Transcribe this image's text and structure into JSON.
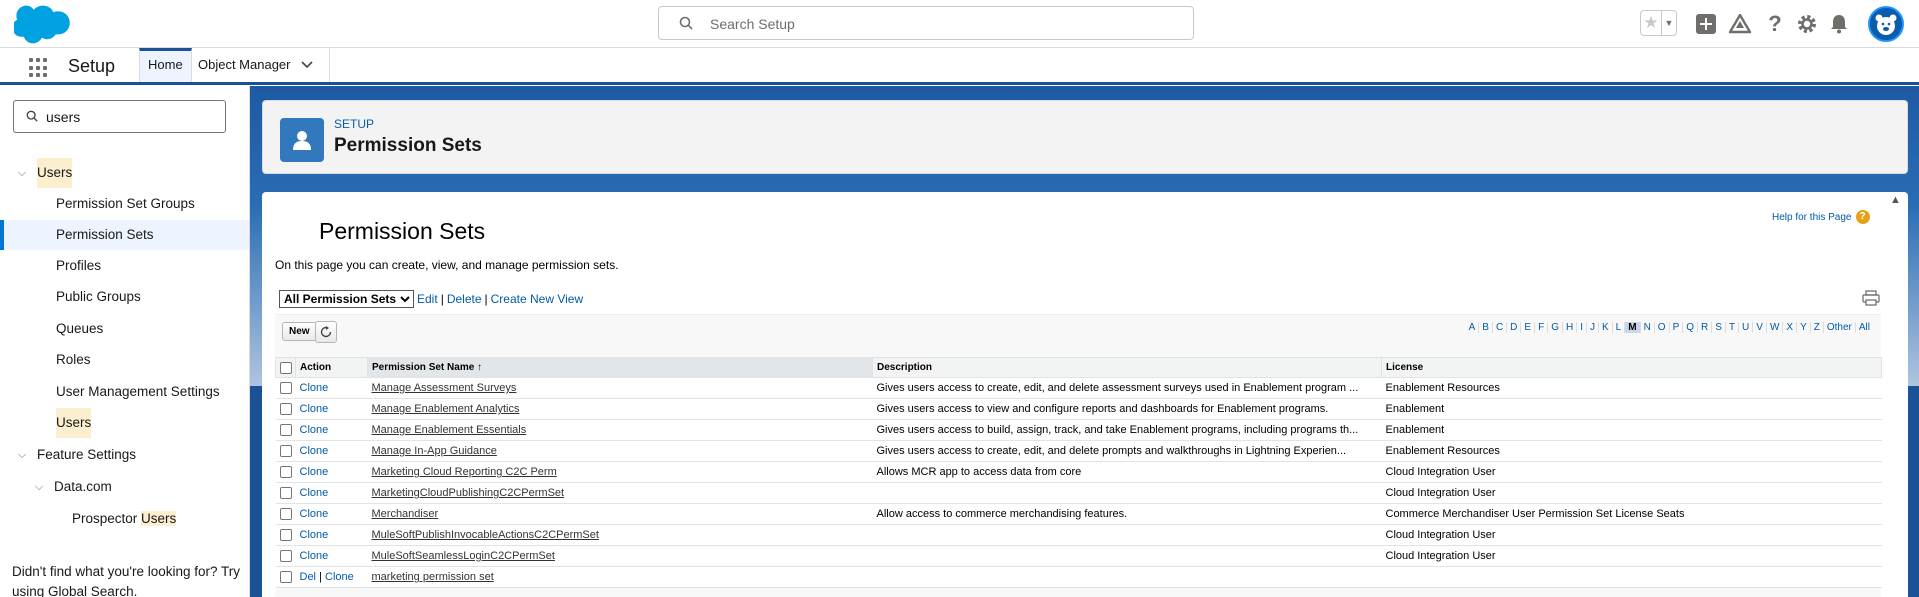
{
  "header": {
    "search_placeholder": "Search Setup",
    "icons": [
      "favorites-star-icon",
      "favorites-dropdown-icon",
      "global-actions-plus-icon",
      "trailhead-icon",
      "help-icon",
      "setup-gear-icon",
      "notifications-bell-icon",
      "avatar"
    ]
  },
  "nav": {
    "app_name": "Setup",
    "tabs": [
      {
        "label": "Home"
      },
      {
        "label": "Object Manager"
      }
    ]
  },
  "sidebar": {
    "quickfind_value": "users",
    "tree": [
      {
        "label": "Users",
        "highlight": true
      },
      {
        "label": "Permission Set Groups"
      },
      {
        "label": "Permission Sets"
      },
      {
        "label": "Profiles"
      },
      {
        "label": "Public Groups"
      },
      {
        "label": "Queues"
      },
      {
        "label": "Roles"
      },
      {
        "label": "User Management Settings"
      },
      {
        "label": "Users"
      },
      {
        "label": "Feature Settings"
      },
      {
        "label": "Data.com"
      },
      {
        "label_prefix": "Prospector ",
        "label_hl": "Users"
      }
    ],
    "not_found": "Didn't find what you're looking for? Try using Global Search."
  },
  "page_header": {
    "eyebrow": "SETUP",
    "title": "Permission Sets"
  },
  "content": {
    "title": "Permission Sets",
    "help_link": "Help for this Page",
    "description": "On this page you can create, view, and manage permission sets.",
    "view_select": "All Permission Sets",
    "view_links": {
      "edit": "Edit",
      "delete": "Delete",
      "create": "Create New View"
    },
    "new_button": "New",
    "alpha": [
      "A",
      "B",
      "C",
      "D",
      "E",
      "F",
      "G",
      "H",
      "I",
      "J",
      "K",
      "L",
      "M",
      "N",
      "O",
      "P",
      "Q",
      "R",
      "S",
      "T",
      "U",
      "V",
      "W",
      "X",
      "Y",
      "Z",
      "Other",
      "All"
    ],
    "alpha_selected": "M",
    "columns": {
      "action": "Action",
      "name": "Permission Set Name ↑",
      "description": "Description",
      "license": "License"
    },
    "rows": [
      {
        "del": "",
        "action": "Clone",
        "name": "Manage Assessment Surveys",
        "description": "Gives users access to create, edit, and delete assessment surveys used in Enablement program ...",
        "license": "Enablement Resources"
      },
      {
        "del": "",
        "action": "Clone",
        "name": "Manage Enablement Analytics",
        "description": "Gives users access to view and configure reports and dashboards for Enablement programs.",
        "license": "Enablement"
      },
      {
        "del": "",
        "action": "Clone",
        "name": "Manage Enablement Essentials",
        "description": "Gives users access to build, assign, track, and take Enablement programs, including programs th...",
        "license": "Enablement"
      },
      {
        "del": "",
        "action": "Clone",
        "name": "Manage In-App Guidance",
        "description": "Gives users access to create, edit, and delete prompts and walkthroughs in Lightning Experien...",
        "license": "Enablement Resources"
      },
      {
        "del": "",
        "action": "Clone",
        "name": "Marketing Cloud Reporting C2C Perm",
        "description": "Allows MCR app to access data from core",
        "license": "Cloud Integration User"
      },
      {
        "del": "",
        "action": "Clone",
        "name": "MarketingCloudPublishingC2CPermSet",
        "description": "",
        "license": "Cloud Integration User"
      },
      {
        "del": "",
        "action": "Clone",
        "name": "Merchandiser",
        "description": "Allow access to commerce merchandising features.",
        "license": "Commerce Merchandiser User Permission Set License Seats"
      },
      {
        "del": "",
        "action": "Clone",
        "name": "MuleSoftPublishInvocableActionsC2CPermSet",
        "description": "",
        "license": "Cloud Integration User"
      },
      {
        "del": "",
        "action": "Clone",
        "name": "MuleSoftSeamlessLoginC2CPermSet",
        "description": "",
        "license": "Cloud Integration User"
      },
      {
        "del": "Del",
        "action": "Clone",
        "name": "marketing permission set",
        "description": "",
        "license": ""
      }
    ]
  }
}
